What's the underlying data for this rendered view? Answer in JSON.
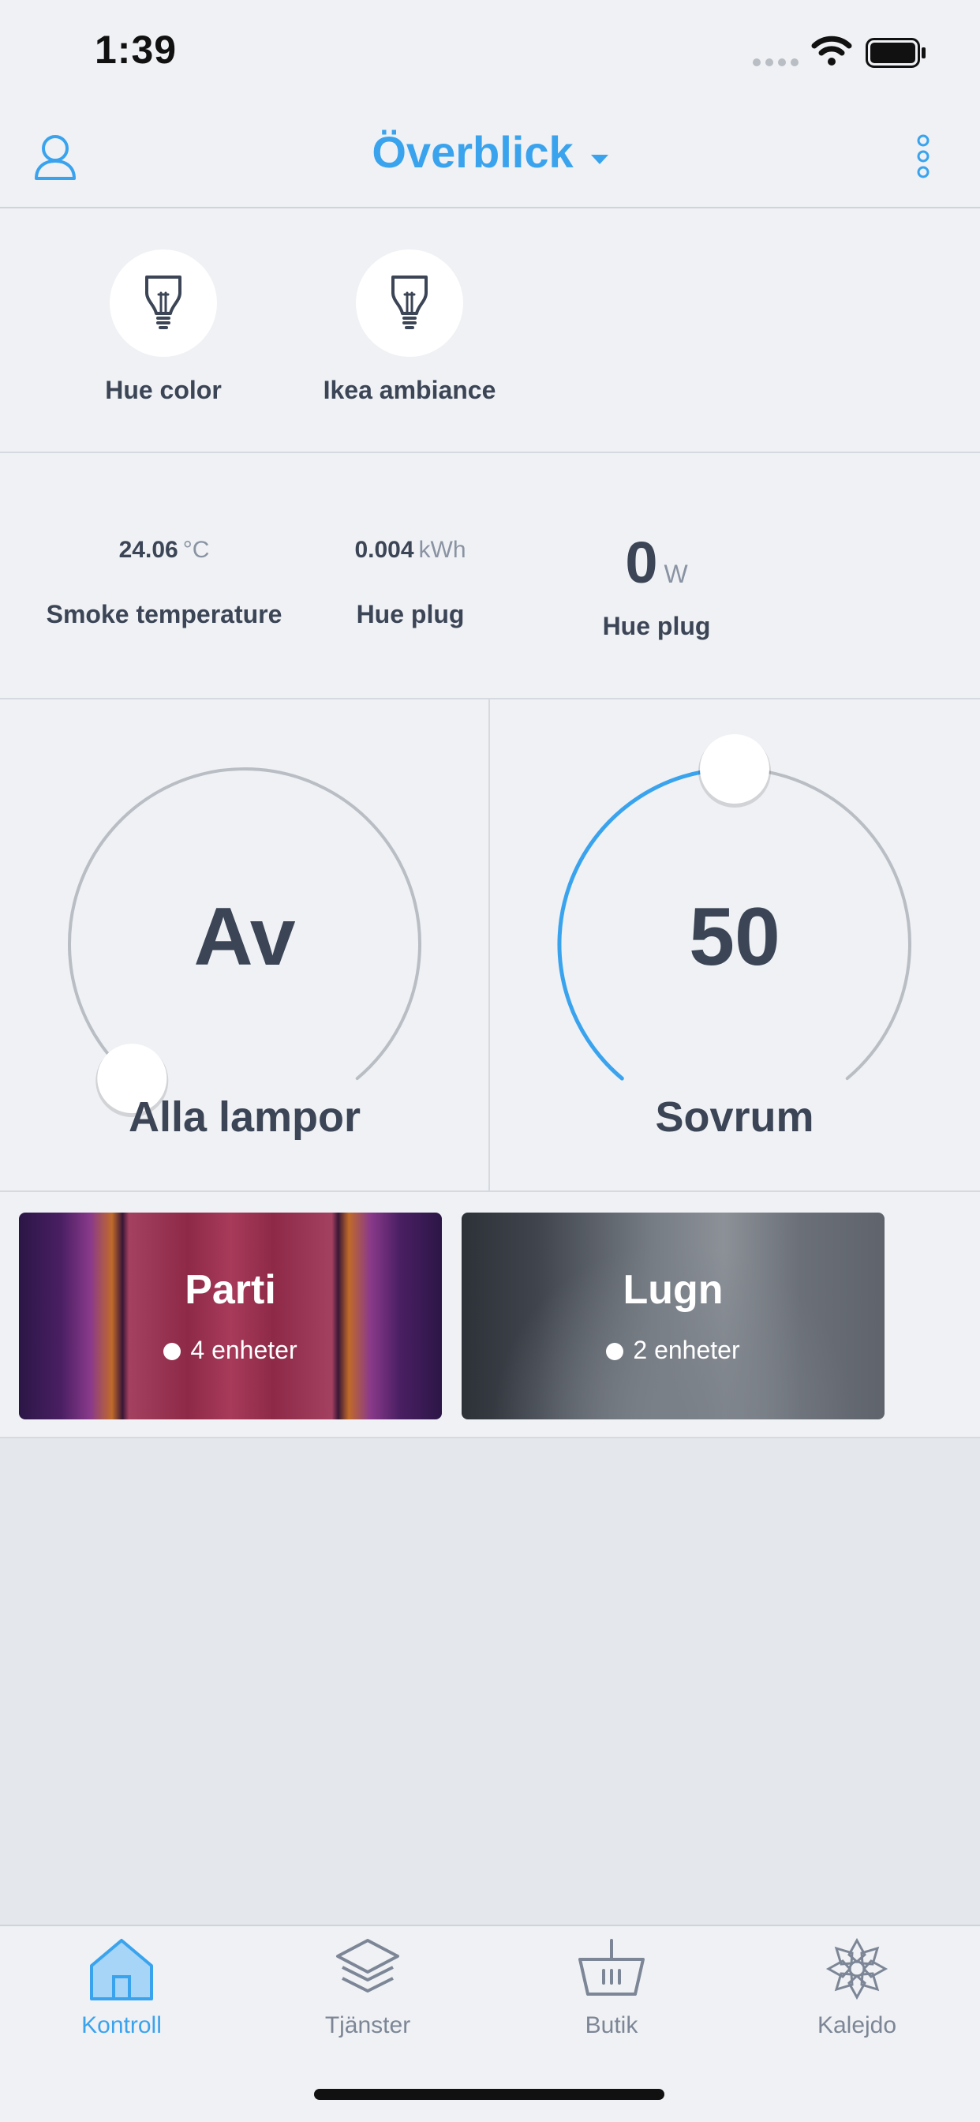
{
  "status_bar": {
    "time": "1:39"
  },
  "header": {
    "title": "Överblick"
  },
  "devices": [
    {
      "label": "Hue color",
      "icon": "lightbulb-icon"
    },
    {
      "label": "Ikea ambiance",
      "icon": "lightbulb-icon"
    }
  ],
  "sensors": [
    {
      "value": "24.06",
      "unit": "°C",
      "label": "Smoke temperature"
    },
    {
      "value": "0.004",
      "unit": "kWh",
      "label": "Hue plug"
    },
    {
      "value": "0",
      "unit": "W",
      "label": "Hue plug"
    }
  ],
  "dials": [
    {
      "value": "Av",
      "name": "Alla lampor",
      "level": 0
    },
    {
      "value": "50",
      "name": "Sovrum",
      "level": 50
    }
  ],
  "scenes": [
    {
      "title": "Parti",
      "devices": "4 enheter"
    },
    {
      "title": "Lugn",
      "devices": "2 enheter"
    }
  ],
  "tabs": [
    {
      "label": "Kontroll",
      "icon": "home-icon",
      "active": true
    },
    {
      "label": "Tjänster",
      "icon": "layers-icon",
      "active": false
    },
    {
      "label": "Butik",
      "icon": "basket-icon",
      "active": false
    },
    {
      "label": "Kalejdo",
      "icon": "kaleidoscope-icon",
      "active": false
    }
  ],
  "colors": {
    "accent": "#3aa3ee",
    "text": "#3b4556",
    "track": "#b9bdc4"
  }
}
